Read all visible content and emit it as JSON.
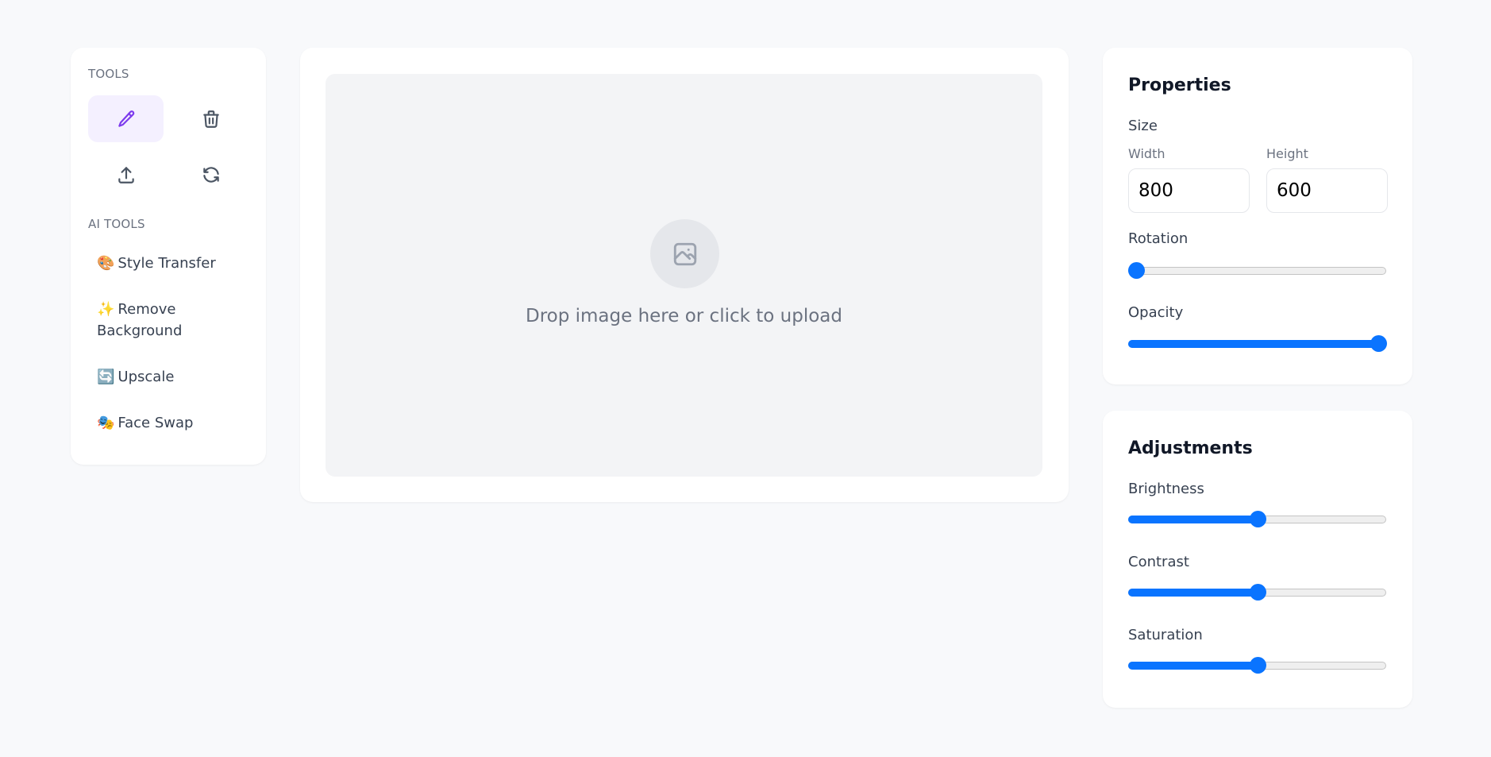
{
  "sidebar": {
    "tools_heading": "TOOLS",
    "tools": [
      {
        "name": "edit",
        "icon": "pencil-icon",
        "active": true
      },
      {
        "name": "delete",
        "icon": "trash-icon",
        "active": false
      },
      {
        "name": "upload",
        "icon": "upload-icon",
        "active": false
      },
      {
        "name": "reset",
        "icon": "refresh-icon",
        "active": false
      }
    ],
    "ai_tools_heading": "AI TOOLS",
    "ai_tools": [
      {
        "emoji": "🎨",
        "label": "Style Transfer"
      },
      {
        "emoji": "✨",
        "label": "Remove Background"
      },
      {
        "emoji": "🔄",
        "label": "Upscale"
      },
      {
        "emoji": "🎭",
        "label": "Face Swap"
      }
    ]
  },
  "canvas": {
    "drop_text": "Drop image here or click to upload",
    "icon": "image-icon"
  },
  "properties": {
    "title": "Properties",
    "size_label": "Size",
    "width_label": "Width",
    "width_value": "800",
    "height_label": "Height",
    "height_value": "600",
    "rotation_label": "Rotation",
    "rotation_value": 0,
    "rotation_range": [
      0,
      360
    ],
    "opacity_label": "Opacity",
    "opacity_value": 100,
    "opacity_range": [
      0,
      100
    ]
  },
  "adjustments": {
    "title": "Adjustments",
    "brightness_label": "Brightness",
    "brightness_value": 50,
    "contrast_label": "Contrast",
    "contrast_value": 50,
    "saturation_label": "Saturation",
    "saturation_value": 50,
    "range": [
      0,
      100
    ]
  },
  "colors": {
    "accent": "#0a74ff",
    "active_tool_bg": "#f4f0ff",
    "active_tool_icon": "#7c3aed",
    "icon_default": "#4b5563",
    "background": "#f8f9fb"
  }
}
